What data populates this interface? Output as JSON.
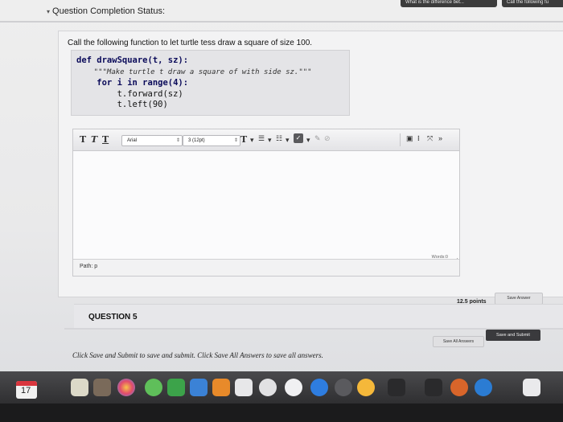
{
  "browser_tabs": [
    "What is the difference bet...",
    "Call the following fu"
  ],
  "status": {
    "label": "Question Completion Status:"
  },
  "question": {
    "prompt": "Call the following function to let turtle tess draw a square of size 100.",
    "code": [
      "def drawSquare(t, sz):",
      "    \"\"\"Make turtle t draw a square of with side sz.\"\"\"",
      "    for i in range(4):",
      "        t.forward(sz)",
      "        t.left(90)"
    ]
  },
  "editor": {
    "toolbar": {
      "bold": "T",
      "italic": "T",
      "underline": "T",
      "font_family": "Arial",
      "font_size": "3 (12pt)",
      "text_color": "T"
    },
    "words_label": "Words:0",
    "path_label": "Path: p"
  },
  "points": "12.5 points",
  "save_answer_label": "Save Answer",
  "question5_label": "QUESTION 5",
  "footer": {
    "instruction": "Click Save and Submit to save and submit. Click Save All Answers to save all answers.",
    "save_all_label": "Save All Answers",
    "save_submit_label": "Save and Submit"
  },
  "dock": {
    "calendar_day": "17"
  },
  "colors": {
    "accent": "#d9363e",
    "submit_bg": "#3a3a3d"
  }
}
